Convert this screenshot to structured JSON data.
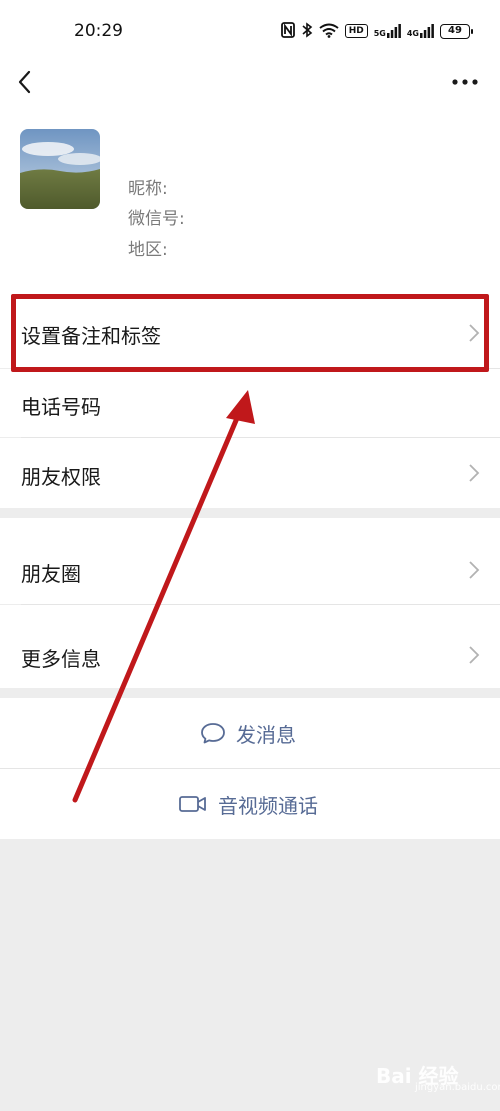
{
  "status_bar": {
    "time": "20:29",
    "icons": [
      "nfc-icon",
      "bluetooth-icon",
      "wifi-icon",
      "hd-icon",
      "signal-5g-icon",
      "signal-4g-icon",
      "battery-icon"
    ],
    "hd_label": "HD",
    "net1_label": "5G",
    "net2_label": "4G",
    "battery_level": "49"
  },
  "nav": {
    "back_icon": "chevron-left-icon",
    "more_icon": "more-dots-icon"
  },
  "profile": {
    "nickname_label": "昵称:",
    "wechat_id_label": "微信号:",
    "region_label": "地区:"
  },
  "menu": {
    "remark_tags": "设置备注和标签",
    "phone_number": "电话号码",
    "friend_permissions": "朋友权限",
    "moments": "朋友圈",
    "more_info": "更多信息"
  },
  "actions": {
    "send_message": "发消息",
    "video_call": "音视频通话"
  },
  "annotation": {
    "highlight_color": "#c0181b",
    "arrow_color": "#c0181b"
  },
  "watermark": {
    "text": "Bai 经验",
    "sub": "jingyan.baidu.com"
  },
  "colors": {
    "link_blue": "#576b95",
    "page_bg": "#ededed",
    "card_bg": "#ffffff",
    "label_gray": "#7a7a7a"
  }
}
